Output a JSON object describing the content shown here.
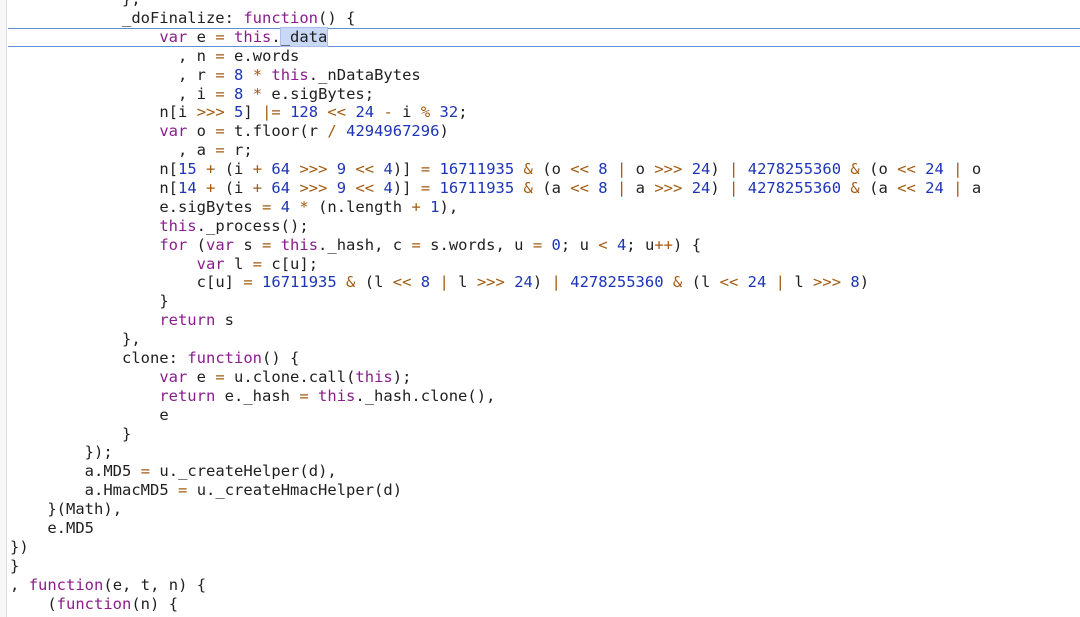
{
  "editor": {
    "lines": [
      {
        "text": "            },",
        "active": false
      },
      {
        "text": "            _doFinalize: function() {",
        "active": false
      },
      {
        "text": "                var e = this._data",
        "active": true,
        "highlight": "_data"
      },
      {
        "text": "                  , n = e.words",
        "active": false
      },
      {
        "text": "                  , r = 8 * this._nDataBytes",
        "active": false
      },
      {
        "text": "                  , i = 8 * e.sigBytes;",
        "active": false
      },
      {
        "text": "                n[i >>> 5] |= 128 << 24 - i % 32;",
        "active": false
      },
      {
        "text": "                var o = t.floor(r / 4294967296)",
        "active": false
      },
      {
        "text": "                  , a = r;",
        "active": false
      },
      {
        "text": "                n[15 + (i + 64 >>> 9 << 4)] = 16711935 & (o << 8 | o >>> 24) | 4278255360 & (o << 24 | o",
        "active": false
      },
      {
        "text": "                n[14 + (i + 64 >>> 9 << 4)] = 16711935 & (a << 8 | a >>> 24) | 4278255360 & (a << 24 | a",
        "active": false
      },
      {
        "text": "                e.sigBytes = 4 * (n.length + 1),",
        "active": false
      },
      {
        "text": "                this._process();",
        "active": false
      },
      {
        "text": "                for (var s = this._hash, c = s.words, u = 0; u < 4; u++) {",
        "active": false
      },
      {
        "text": "                    var l = c[u];",
        "active": false
      },
      {
        "text": "                    c[u] = 16711935 & (l << 8 | l >>> 24) | 4278255360 & (l << 24 | l >>> 8)",
        "active": false
      },
      {
        "text": "                }",
        "active": false
      },
      {
        "text": "                return s",
        "active": false
      },
      {
        "text": "            },",
        "active": false
      },
      {
        "text": "            clone: function() {",
        "active": false
      },
      {
        "text": "                var e = u.clone.call(this);",
        "active": false
      },
      {
        "text": "                return e._hash = this._hash.clone(),",
        "active": false
      },
      {
        "text": "                e",
        "active": false
      },
      {
        "text": "            }",
        "active": false
      },
      {
        "text": "        });",
        "active": false
      },
      {
        "text": "        a.MD5 = u._createHelper(d),",
        "active": false
      },
      {
        "text": "        a.HmacMD5 = u._createHmacHelper(d)",
        "active": false
      },
      {
        "text": "    }(Math),",
        "active": false
      },
      {
        "text": "    e.MD5",
        "active": false
      },
      {
        "text": "})",
        "active": false
      },
      {
        "text": "}",
        "active": false
      },
      {
        "text": ", function(e, t, n) {",
        "active": false
      },
      {
        "text": "    (function(n) {",
        "active": false
      }
    ]
  },
  "colors": {
    "keyword": "#8a1d8c",
    "number": "#1c35b8",
    "operator": "#a35a10",
    "selection": "#c9d9f5",
    "active_line_border": "#5b8fd6"
  }
}
